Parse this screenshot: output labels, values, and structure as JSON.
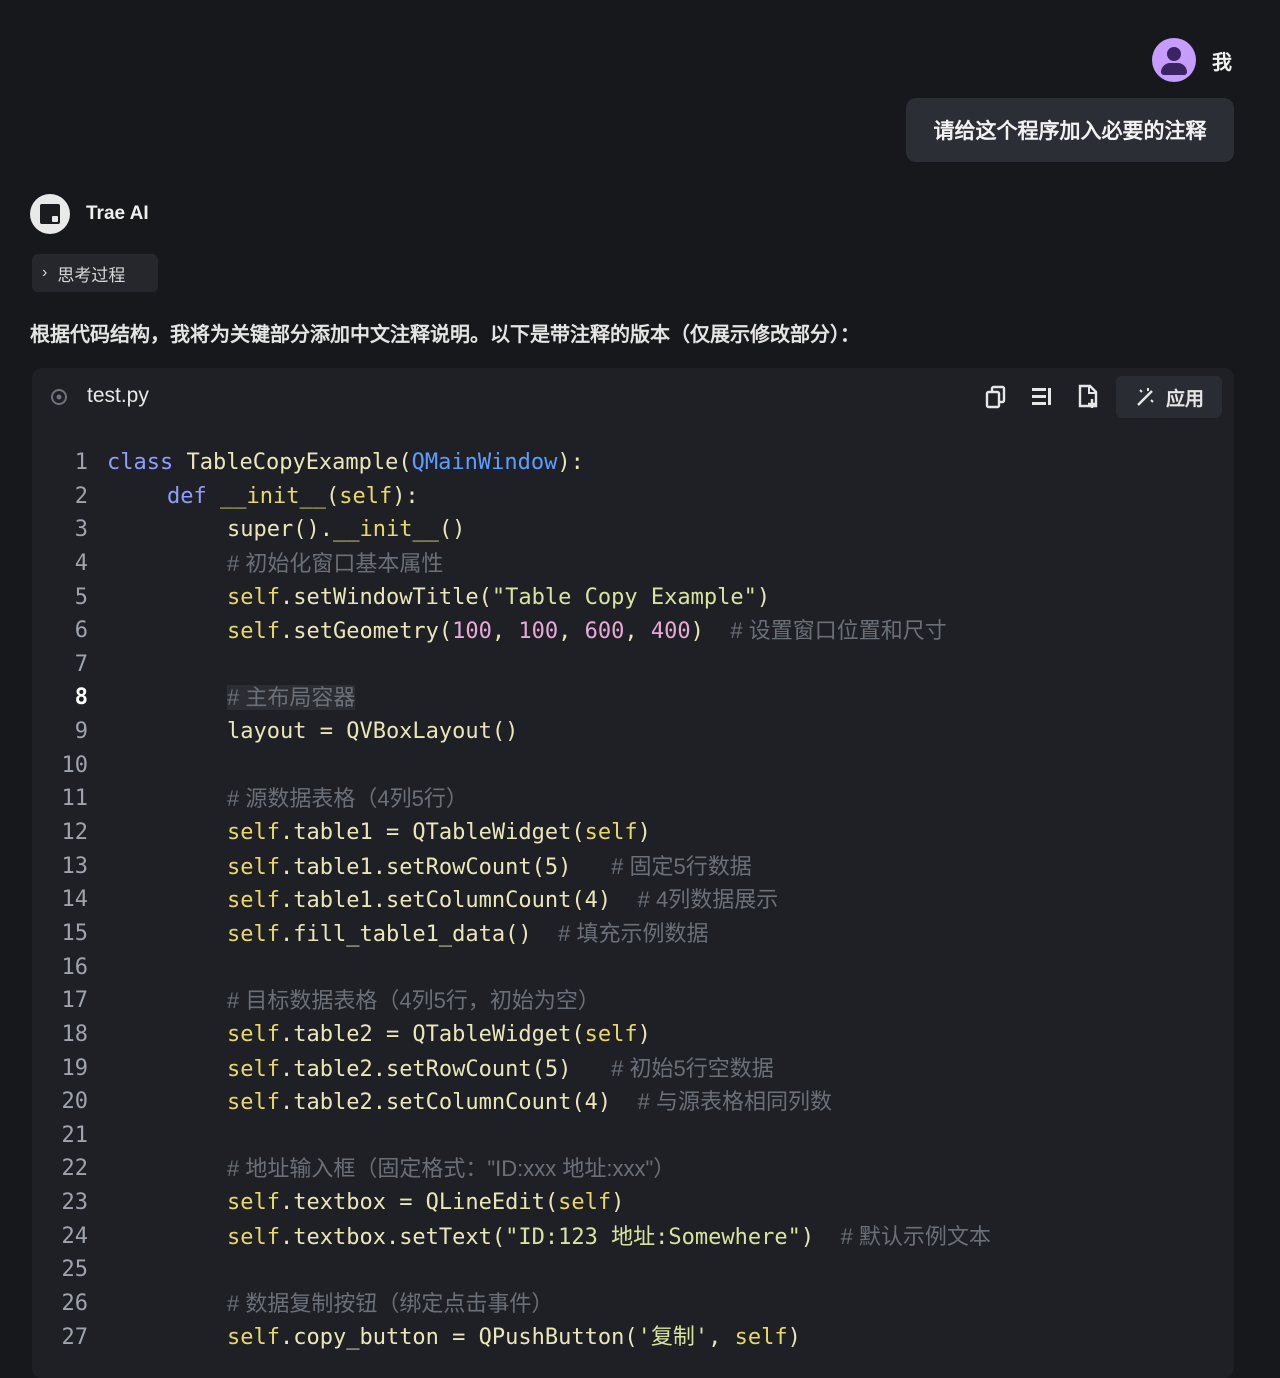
{
  "user": {
    "name": "我",
    "message": "请给这个程序加入必要的注释"
  },
  "assistant": {
    "name": "Trae AI",
    "thinking_label": "思考过程",
    "intro": "根据代码结构，我将为关键部分添加中文注释说明。以下是带注释的版本（仅展示修改部分）："
  },
  "code_block": {
    "filename": "test.py",
    "apply_label": "应用",
    "active_line": 8,
    "lines": [
      {
        "n": "1",
        "indent": 0,
        "tokens": [
          [
            "kw",
            "class "
          ],
          [
            "fn",
            "TableCopyExample("
          ],
          [
            "cls",
            "QMainWindow"
          ],
          [
            "fn",
            "):"
          ]
        ]
      },
      {
        "n": "2",
        "indent": 1,
        "tokens": [
          [
            "kw",
            "def "
          ],
          [
            "slf",
            "__init__"
          ],
          [
            "fn",
            "("
          ],
          [
            "slf",
            "self"
          ],
          [
            "fn",
            "):"
          ]
        ]
      },
      {
        "n": "3",
        "indent": 2,
        "tokens": [
          [
            "fn",
            "super()."
          ],
          [
            "slf",
            "__init__"
          ],
          [
            "fn",
            "()"
          ]
        ]
      },
      {
        "n": "4",
        "indent": 2,
        "tokens": [
          [
            "cm",
            "# 初始化窗口基本属性"
          ]
        ]
      },
      {
        "n": "5",
        "indent": 2,
        "tokens": [
          [
            "slf",
            "self"
          ],
          [
            "fn",
            ".setWindowTitle("
          ],
          [
            "str",
            "\"Table Copy Example\""
          ],
          [
            "fn",
            ")"
          ]
        ]
      },
      {
        "n": "6",
        "indent": 2,
        "tokens": [
          [
            "slf",
            "self"
          ],
          [
            "fn",
            ".setGeometry("
          ],
          [
            "num",
            "100"
          ],
          [
            "fn",
            ", "
          ],
          [
            "num",
            "100"
          ],
          [
            "fn",
            ", "
          ],
          [
            "num",
            "600"
          ],
          [
            "fn",
            ", "
          ],
          [
            "num",
            "400"
          ],
          [
            "fn",
            ")  "
          ],
          [
            "cm",
            "# 设置窗口位置和尺寸"
          ]
        ]
      },
      {
        "n": "7",
        "indent": 2,
        "tokens": []
      },
      {
        "n": "8",
        "indent": 2,
        "tokens": [
          [
            "cm hl",
            "# 主布局容器"
          ]
        ]
      },
      {
        "n": "9",
        "indent": 2,
        "tokens": [
          [
            "fn",
            "layout = QVBoxLayout()"
          ]
        ]
      },
      {
        "n": "10",
        "indent": 2,
        "tokens": []
      },
      {
        "n": "11",
        "indent": 2,
        "tokens": [
          [
            "cm",
            "# 源数据表格（4列5行）"
          ]
        ]
      },
      {
        "n": "12",
        "indent": 2,
        "tokens": [
          [
            "slf",
            "self"
          ],
          [
            "fn",
            ".table1 = QTableWidget("
          ],
          [
            "slf",
            "self"
          ],
          [
            "fn",
            ")"
          ]
        ]
      },
      {
        "n": "13",
        "indent": 2,
        "tokens": [
          [
            "slf",
            "self"
          ],
          [
            "fn",
            ".table1.setRowCount(5)   "
          ],
          [
            "cm",
            "# 固定5行数据"
          ]
        ]
      },
      {
        "n": "14",
        "indent": 2,
        "tokens": [
          [
            "slf",
            "self"
          ],
          [
            "fn",
            ".table1.setColumnCount(4)  "
          ],
          [
            "cm",
            "# 4列数据展示"
          ]
        ]
      },
      {
        "n": "15",
        "indent": 2,
        "tokens": [
          [
            "slf",
            "self"
          ],
          [
            "fn",
            ".fill_table1_data()  "
          ],
          [
            "cm",
            "# 填充示例数据"
          ]
        ]
      },
      {
        "n": "16",
        "indent": 2,
        "tokens": []
      },
      {
        "n": "17",
        "indent": 2,
        "tokens": [
          [
            "cm",
            "# 目标数据表格（4列5行，初始为空）"
          ]
        ]
      },
      {
        "n": "18",
        "indent": 2,
        "tokens": [
          [
            "slf",
            "self"
          ],
          [
            "fn",
            ".table2 = QTableWidget("
          ],
          [
            "slf",
            "self"
          ],
          [
            "fn",
            ")"
          ]
        ]
      },
      {
        "n": "19",
        "indent": 2,
        "tokens": [
          [
            "slf",
            "self"
          ],
          [
            "fn",
            ".table2.setRowCount(5)   "
          ],
          [
            "cm",
            "# 初始5行空数据"
          ]
        ]
      },
      {
        "n": "20",
        "indent": 2,
        "tokens": [
          [
            "slf",
            "self"
          ],
          [
            "fn",
            ".table2.setColumnCount(4)  "
          ],
          [
            "cm",
            "# 与源表格相同列数"
          ]
        ]
      },
      {
        "n": "21",
        "indent": 2,
        "tokens": []
      },
      {
        "n": "22",
        "indent": 2,
        "tokens": [
          [
            "cm",
            "# 地址输入框（固定格式：\"ID:xxx 地址:xxx\"）"
          ]
        ]
      },
      {
        "n": "23",
        "indent": 2,
        "tokens": [
          [
            "slf",
            "self"
          ],
          [
            "fn",
            ".textbox = QLineEdit("
          ],
          [
            "slf",
            "self"
          ],
          [
            "fn",
            ")"
          ]
        ]
      },
      {
        "n": "24",
        "indent": 2,
        "tokens": [
          [
            "slf",
            "self"
          ],
          [
            "fn",
            ".textbox.setText("
          ],
          [
            "str",
            "\"ID:123 地址:Somewhere\""
          ],
          [
            "fn",
            ")  "
          ],
          [
            "cm",
            "# 默认示例文本"
          ]
        ]
      },
      {
        "n": "25",
        "indent": 2,
        "tokens": []
      },
      {
        "n": "26",
        "indent": 2,
        "tokens": [
          [
            "cm",
            "# 数据复制按钮（绑定点击事件）"
          ]
        ]
      },
      {
        "n": "27",
        "indent": 2,
        "tokens": [
          [
            "slf",
            "self"
          ],
          [
            "fn",
            ".copy_button = QPushButton("
          ],
          [
            "str",
            "'复制'"
          ],
          [
            "fn",
            ", "
          ],
          [
            "slf",
            "self"
          ],
          [
            "fn",
            ")"
          ]
        ]
      }
    ]
  },
  "colors": {
    "background": "#17181c",
    "code_bg": "#1f2026",
    "accent_avatar": "#c79cff"
  }
}
